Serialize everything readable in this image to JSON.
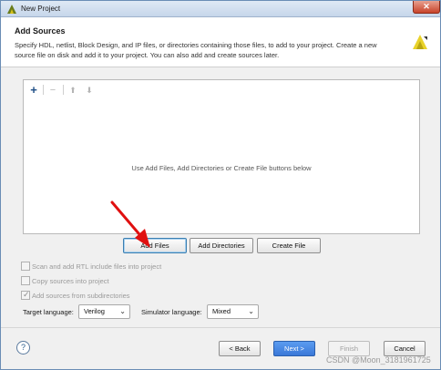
{
  "window": {
    "title": "New Project"
  },
  "header": {
    "title": "Add Sources",
    "description": "Specify HDL, netlist, Block Design, and IP files, or directories containing those files, to add to your project. Create a new source file on disk and add it to your project. You can also add and create sources later."
  },
  "toolbar": {
    "add": "+",
    "remove": "−",
    "move_up": "⬆",
    "move_down": "⬇"
  },
  "list": {
    "hint": "Use Add Files, Add Directories or Create File buttons below"
  },
  "actions": {
    "add_files": "Add Files",
    "add_directories": "Add Directories",
    "create_file": "Create File"
  },
  "options": {
    "scan_rtl": "Scan and add RTL include files into project",
    "copy_sources": "Copy sources into project",
    "add_subdirs": "Add sources from subdirectories",
    "add_subdirs_checked": true
  },
  "languages": {
    "target_label": "Target language:",
    "target_value": "Verilog",
    "simulator_label": "Simulator language:",
    "simulator_value": "Mixed"
  },
  "footer": {
    "help": "?",
    "back": "< Back",
    "next": "Next >",
    "finish": "Finish",
    "cancel": "Cancel"
  },
  "watermark": "CSDN @Moon_3181961725",
  "colors": {
    "primary_button": "#3a78d8",
    "arrow": "#e01010",
    "logo": "#d8c21a"
  }
}
